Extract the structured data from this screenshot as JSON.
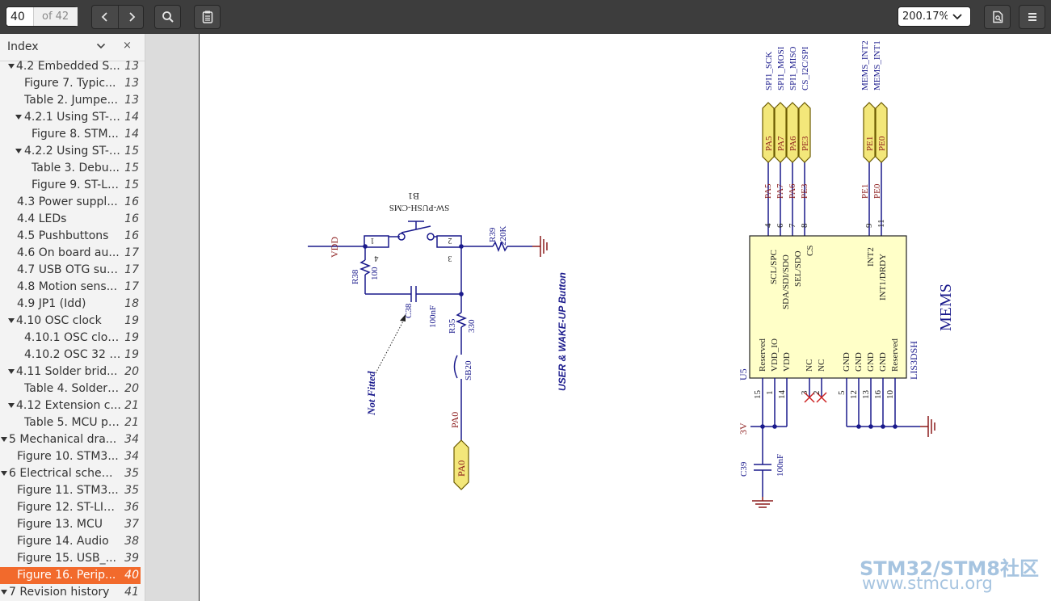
{
  "toolbar": {
    "page_number": "40",
    "page_of": "of 42",
    "zoom": "200.17%",
    "icons": [
      "chevron-left-icon",
      "chevron-right-icon",
      "search-icon",
      "annotations-icon",
      "chevron-down-icon",
      "document-properties-icon",
      "menu-icon"
    ]
  },
  "sidebar": {
    "title": "Index",
    "close": "×",
    "items": [
      {
        "label": "4.2 Embedded S...",
        "page": "13",
        "expanded": true
      },
      {
        "label": "Figure 7. Typic...",
        "page": "13"
      },
      {
        "label": "Table 2. Jumpe...",
        "page": "13"
      },
      {
        "label": "4.2.1 Using ST-L...",
        "page": "14",
        "expanded": true
      },
      {
        "label": "Figure 8. STM...",
        "page": "14"
      },
      {
        "label": "4.2.2 Using ST-L...",
        "page": "15",
        "expanded": true
      },
      {
        "label": "Table 3. Debu...",
        "page": "15"
      },
      {
        "label": "Figure 9. ST-Li...",
        "page": "15"
      },
      {
        "label": "4.3 Power suppl...",
        "page": "16"
      },
      {
        "label": "4.4 LEDs",
        "page": "16"
      },
      {
        "label": "4.5 Pushbuttons",
        "page": "16"
      },
      {
        "label": "4.6 On board au...",
        "page": "17"
      },
      {
        "label": "4.7 USB OTG sup...",
        "page": "17"
      },
      {
        "label": "4.8 Motion sens...",
        "page": "17"
      },
      {
        "label": "4.9 JP1 (Idd)",
        "page": "18"
      },
      {
        "label": "4.10 OSC clock",
        "page": "19",
        "expanded": true
      },
      {
        "label": "4.10.1 OSC cloc...",
        "page": "19"
      },
      {
        "label": "4.10.2 OSC 32 K...",
        "page": "19"
      },
      {
        "label": "4.11 Solder brid...",
        "page": "20",
        "expanded": true
      },
      {
        "label": "Table 4. Solder ...",
        "page": "20"
      },
      {
        "label": "4.12 Extension c...",
        "page": "21",
        "expanded": true
      },
      {
        "label": "Table 5. MCU pi...",
        "page": "21"
      },
      {
        "label": "5 Mechanical dra...",
        "page": "34",
        "expanded": true
      },
      {
        "label": "Figure 10. STM3...",
        "page": "34"
      },
      {
        "label": "6 Electrical schem...",
        "page": "35",
        "expanded": true
      },
      {
        "label": "Figure 11. STM3...",
        "page": "35"
      },
      {
        "label": "Figure 12. ST-LIN...",
        "page": "36"
      },
      {
        "label": "Figure 13. MCU",
        "page": "37"
      },
      {
        "label": "Figure 14. Audio",
        "page": "38"
      },
      {
        "label": "Figure 15. USB_...",
        "page": "39"
      },
      {
        "label": "Figure 16. Perip...",
        "page": "40",
        "selected": true
      },
      {
        "label": "7 Revision history",
        "page": "41",
        "expanded": true
      }
    ]
  },
  "schematic": {
    "button": {
      "vdd": "VDD",
      "r38": "R38",
      "r38_val": "100",
      "c38": "C38",
      "c38_val": "100nF",
      "r35": "R35",
      "r35_val": "330",
      "r39": "R39",
      "r39_val": "220K",
      "sb20": "SB20",
      "b1": "B1",
      "b1_part": "SW-PUSH-CMS",
      "pins": [
        "1",
        "2",
        "3",
        "4"
      ],
      "net_pa0": "PA0",
      "port_pa0": "PA0",
      "not_fitted": "Not Fitted",
      "title": "USER & WAKE-UP Button"
    },
    "mems": {
      "top_nets": [
        "SPI1_SCK",
        "SPI1_MOSI",
        "SPI1_MISO",
        "CS_I2C/SPI",
        "MEMS_INT2",
        "MEMS_INT1"
      ],
      "ports": [
        "PA5",
        "PA7",
        "PA6",
        "PE3",
        "PE1",
        "PE0"
      ],
      "wire_nets": [
        "PA5",
        "PA7",
        "PA6",
        "PE3",
        "PE1",
        "PE0"
      ],
      "top_pin_numbers": [
        "4",
        "6",
        "7",
        "8",
        "9",
        "11"
      ],
      "top_pin_names": [
        "SCL/SPC",
        "SDA/SDI/SDO",
        "SEL/SDO",
        "CS",
        "INT2",
        "INT1/DRDY"
      ],
      "bottom_pin_names": [
        "Reserved",
        "VDD_IO",
        "VDD",
        "NC",
        "NC",
        "GND",
        "GND",
        "GND",
        "GND",
        "Reserved"
      ],
      "bottom_pin_numbers": [
        "15",
        "1",
        "14",
        "3",
        "2",
        "5",
        "12",
        "13",
        "16",
        "10"
      ],
      "ref": "U5",
      "part": "LIS3DSH",
      "title": "MEMS",
      "net_3v": "3V",
      "c39": "C39",
      "c39_val": "100nF"
    }
  },
  "watermark": {
    "line1": "STM32/STM8社区",
    "line2": "www.stmcu.org"
  },
  "colors": {
    "wire": "#1a1a8c",
    "net_label": "#8b1a1a",
    "port_fill": "#f3e77a",
    "port_stroke": "#6b5a00",
    "ic_fill": "#ffffc8",
    "nc_mark": "#cc2222",
    "selection": "#f26a2c"
  }
}
